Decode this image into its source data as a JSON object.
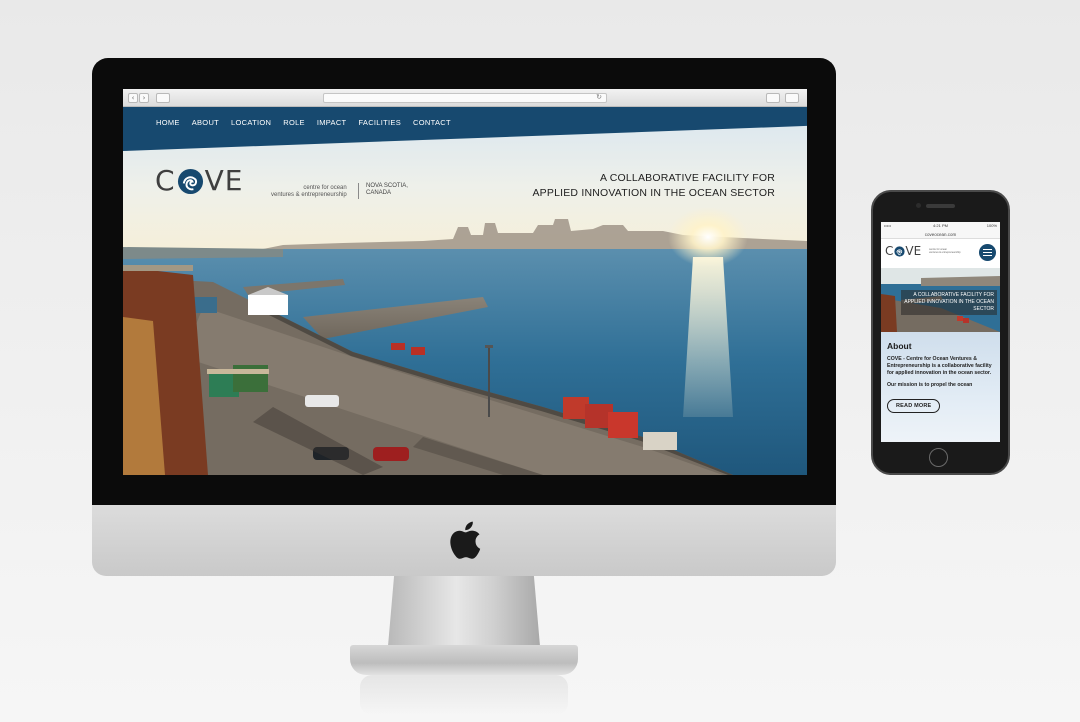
{
  "desktop": {
    "site": {
      "nav": [
        "HOME",
        "ABOUT",
        "LOCATION",
        "ROLE",
        "IMPACT",
        "FACILITIES",
        "CONTACT"
      ],
      "logo": {
        "letters": [
          "C",
          "V",
          "E"
        ],
        "subtitle_line1": "centre for ocean",
        "subtitle_line2": "ventures & entrepreneurship",
        "region_line1": "NOVA SCOTIA,",
        "region_line2": "CANADA"
      },
      "tagline_line1": "A COLLABORATIVE FACILITY FOR",
      "tagline_line2": "APPLIED INNOVATION IN THE OCEAN SECTOR"
    },
    "browser": {
      "back_glyph": "‹",
      "forward_glyph": "›",
      "reload_glyph": "↻"
    }
  },
  "mobile": {
    "status": {
      "carrier": "•••••",
      "time": "4:21 PM",
      "battery": "100%"
    },
    "url": "coveocean.com",
    "logo": {
      "letters": [
        "C",
        "V",
        "E"
      ],
      "subtitle_line1": "centre for ocean",
      "subtitle_line2": "ventures & entrepreneurship"
    },
    "hero_text_line1": "A COLLABORATIVE FACILITY FOR",
    "hero_text_line2": "APPLIED INNOVATION IN THE OCEAN",
    "hero_text_line3": "SECTOR",
    "about": {
      "heading": "About",
      "body": "COVE - Centre for Ocean Ventures & Entrepreneurship is a collaborative facility for applied innovation in the ocean sector.",
      "mission": "Our mission is to propel the ocean",
      "button": "READ MORE"
    }
  },
  "colors": {
    "brand_navy": "#17496f",
    "logo_grey": "#3f3f3f",
    "water": "#2f6f96"
  },
  "icons": [
    "apple-logo-icon",
    "wave-o-logo-icon",
    "hamburger-menu-icon",
    "reload-icon",
    "share-icon",
    "tabs-icon",
    "sidebar-icon"
  ]
}
